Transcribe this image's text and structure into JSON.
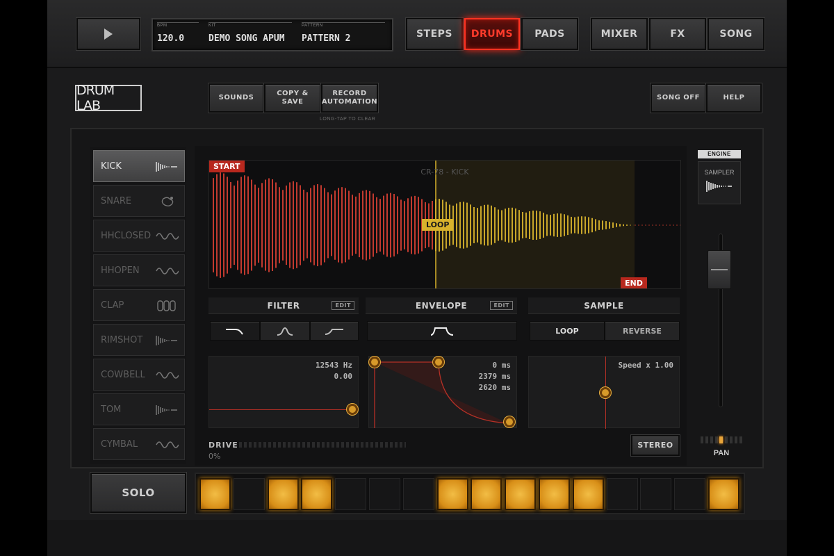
{
  "transport": {
    "play_icon": "play-icon"
  },
  "info": {
    "bpm_label": "BPM",
    "bpm": "120.0",
    "kit_label": "KIT",
    "kit": "DEMO SONG APUM",
    "pattern_label": "PATTERN",
    "pattern": "PATTERN 2"
  },
  "top_nav": {
    "steps": "STEPS",
    "drums": "DRUMS",
    "pads": "PADS",
    "mixer": "MIXER",
    "fx": "FX",
    "song": "SONG"
  },
  "logo": "DRUM LAB",
  "toolbar": {
    "sounds": "SOUNDS",
    "copy_save": "COPY & SAVE",
    "record_automation": "RECORD AUTOMATION",
    "hint": "LONG-TAP TO CLEAR",
    "song_off": "SONG OFF",
    "help": "HELP"
  },
  "instruments": [
    {
      "name": "KICK",
      "icon": "kick-wave-icon",
      "selected": true
    },
    {
      "name": "SNARE",
      "icon": "snare-icon"
    },
    {
      "name": "HHCLOSED",
      "icon": "hihat-wave-icon"
    },
    {
      "name": "HHOPEN",
      "icon": "hihat-wave-icon"
    },
    {
      "name": "CLAP",
      "icon": "clap-icon"
    },
    {
      "name": "RIMSHOT",
      "icon": "kick-wave-icon"
    },
    {
      "name": "COWBELL",
      "icon": "hihat-wave-icon"
    },
    {
      "name": "TOM",
      "icon": "kick-wave-icon"
    },
    {
      "name": "CYMBAL",
      "icon": "hihat-wave-icon"
    }
  ],
  "solo": "SOLO",
  "waveform": {
    "title": "CR-78 - KICK",
    "start": "START",
    "loop": "LOOP",
    "end": "END"
  },
  "filter": {
    "title": "FILTER",
    "edit": "EDIT",
    "freq": "12543 Hz",
    "res": "0.00"
  },
  "envelope": {
    "title": "ENVELOPE",
    "edit": "EDIT",
    "attack": "0 ms",
    "decay": "2379 ms",
    "release": "2620 ms"
  },
  "sample": {
    "title": "SAMPLE",
    "loop": "LOOP",
    "reverse": "REVERSE",
    "speed": "Speed x 1.00",
    "stereo": "STEREO"
  },
  "drive": {
    "label": "DRIVE",
    "value": "0%"
  },
  "engine": {
    "label": "ENGINE",
    "sampler": "SAMPLER"
  },
  "pan": {
    "label": "PAN"
  },
  "steps": [
    true,
    false,
    true,
    true,
    false,
    false,
    false,
    true,
    true,
    true,
    true,
    true,
    false,
    false,
    false,
    true
  ],
  "colors": {
    "accent_red": "#ff3322",
    "wave_red": "#c23a2f",
    "wave_yellow": "#c8a62a",
    "step_on": "#e8a532"
  }
}
